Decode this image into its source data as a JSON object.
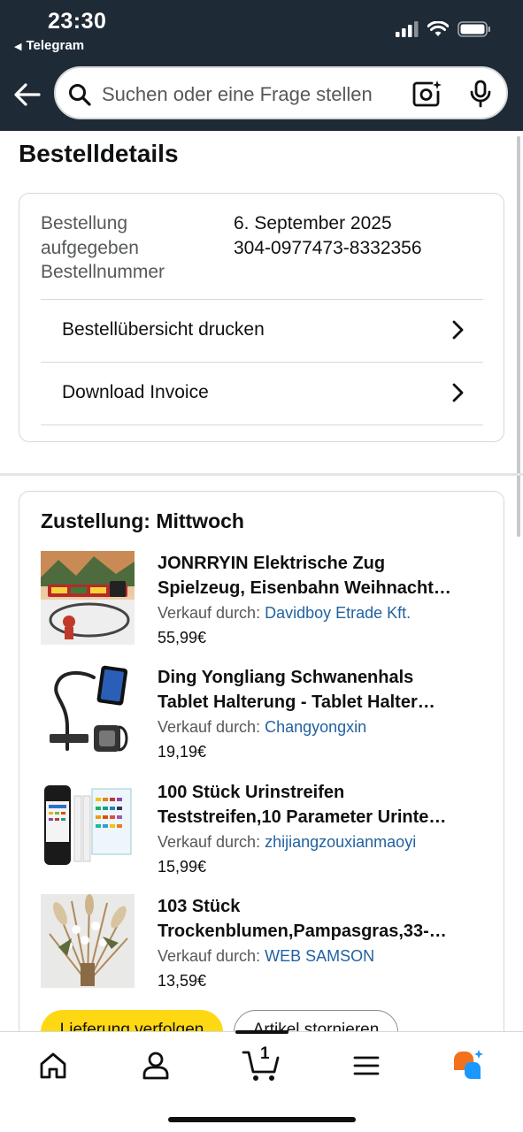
{
  "status_bar": {
    "time": "23:30",
    "back_app": "Telegram"
  },
  "search": {
    "placeholder": "Suchen oder eine Frage stellen"
  },
  "page_title": "Bestelldetails",
  "order": {
    "labels": [
      "Bestellung aufgegeben",
      "Bestellnummer"
    ],
    "date": "6. September 2025",
    "number": "304-0977473-8332356",
    "actions": [
      {
        "label": "Bestellübersicht drucken"
      },
      {
        "label": "Download Invoice"
      }
    ]
  },
  "shipment": {
    "title": "Zustellung: Mittwoch",
    "seller_prefix": "Verkauf durch:",
    "items": [
      {
        "name_line1": "JONRRYIN Elektrische Zug",
        "name_line2": "Spielzeug, Eisenbahn Weihnacht…",
        "seller": "Davidboy Etrade Kft.",
        "price": "55,99€"
      },
      {
        "name_line1": "Ding Yongliang Schwanenhals",
        "name_line2": "Tablet Halterung - Tablet Halter…",
        "seller": "Changyongxin",
        "price": "19,19€"
      },
      {
        "name_line1": "100 Stück Urinstreifen",
        "name_line2": "Teststreifen,10 Parameter Urinte…",
        "seller": "zhijiangzouxianmaoyi",
        "price": "15,99€"
      },
      {
        "name_line1": "103 Stück",
        "name_line2": "Trockenblumen,Pampasgras,33-…",
        "seller": "WEB SAMSON",
        "price": "13,59€"
      }
    ],
    "buttons": {
      "track": "Lieferung verfolgen",
      "cancel": "Artikel stornieren"
    }
  },
  "bottom_nav": {
    "cart_count": "1",
    "items": [
      "home-icon",
      "account-icon",
      "cart-icon",
      "menu-icon",
      "rufus-ai-icon"
    ]
  },
  "colors": {
    "header_bg": "#1f2a37",
    "link": "#2162a1",
    "primary_button": "#ffd814",
    "rufus_orange": "#f2711c",
    "rufus_blue": "#1a98ff"
  }
}
